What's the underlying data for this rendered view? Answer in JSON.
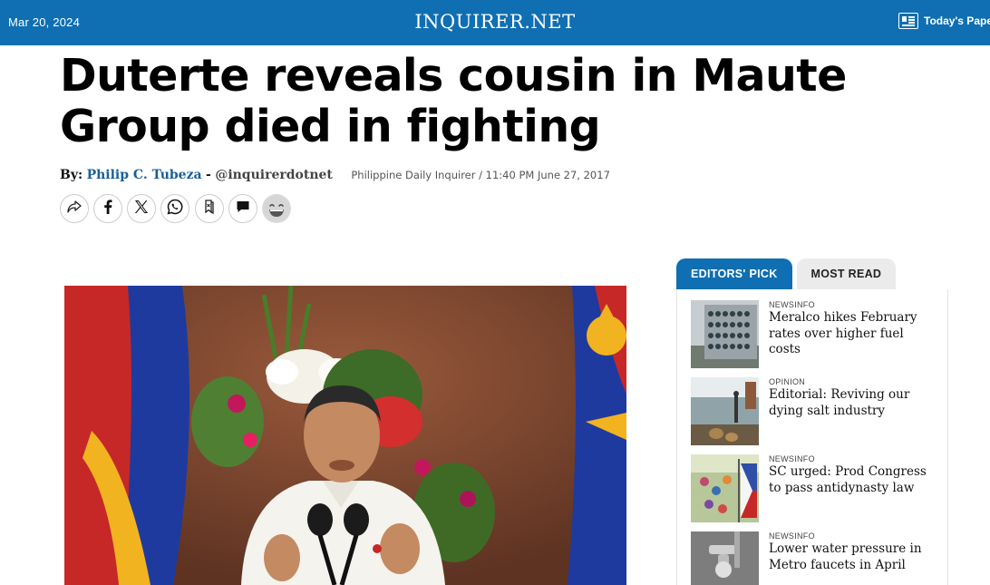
{
  "topbar": {
    "date": "Mar 20, 2024",
    "logo": "INQUIRER.NET",
    "todays_paper": "Today's Paper"
  },
  "article": {
    "headline": "Duterte reveals cousin in Maute Group died in fighting",
    "byline": {
      "by": "By:",
      "author": "Philip C. Tubeza",
      "separator": "-",
      "handle": "@inquirerdotnet",
      "source": "Philippine Daily Inquirer / 11:40 PM June 27, 2017"
    },
    "share_buttons": [
      "share-icon",
      "facebook-icon",
      "x-icon",
      "whatsapp-icon",
      "bookmark-icon",
      "comment-icon",
      "laugh-emoji-icon"
    ]
  },
  "sidebar": {
    "tabs": [
      {
        "label": "EDITORS' PICK",
        "active": true
      },
      {
        "label": "MOST READ",
        "active": false
      }
    ],
    "items": [
      {
        "category": "NEWSINFO",
        "title": "Meralco hikes February rates over higher fuel costs"
      },
      {
        "category": "OPINION",
        "title": "Editorial: Reviving our dying salt industry"
      },
      {
        "category": "NEWSINFO",
        "title": "SC urged: Prod Congress to pass antidynasty law"
      },
      {
        "category": "NEWSINFO",
        "title": "Lower water pressure in Metro faucets in April"
      }
    ]
  },
  "colors": {
    "brand_blue": "#0f6fb2",
    "author_link": "#1a5f97"
  }
}
